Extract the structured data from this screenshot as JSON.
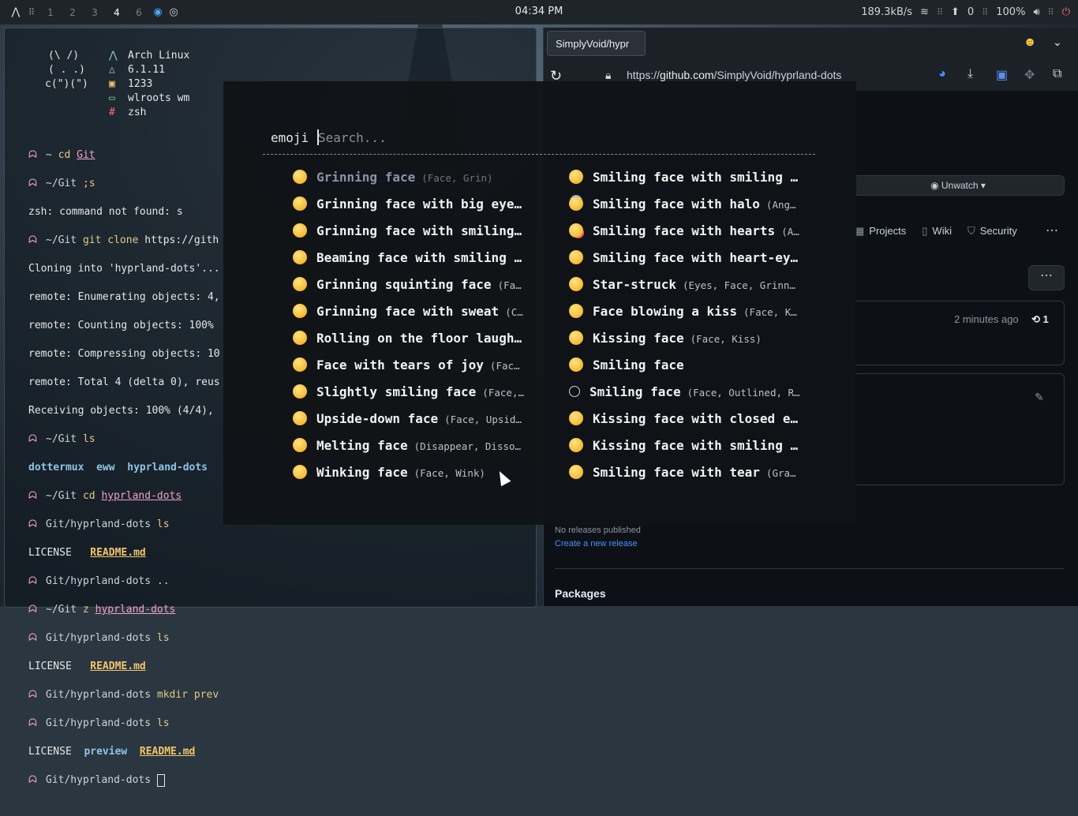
{
  "topbar": {
    "workspaces": [
      "1",
      "2",
      "3",
      "4",
      "6"
    ],
    "active_workspace": "4",
    "clock": "04:34 PM",
    "net_speed": "189.3kB/s",
    "updates": "0",
    "battery": "100%"
  },
  "terminal": {
    "art": [
      "(\\ /)",
      "( . .)",
      "c(\")(\")"
    ],
    "info": {
      "os": "Arch Linux",
      "kernel": "6.1.11",
      "packages": "1233",
      "wm": "wlroots wm",
      "shell": "zsh"
    },
    "lines": {
      "l1_path": "~",
      "l1_cmd": "cd",
      "l1_arg": "Git",
      "l2_path": "~/Git",
      "l2_cmd": ";s",
      "l3": "zsh: command not found: s",
      "l4_path": "~/Git",
      "l4_cmd": "git clone",
      "l4_arg": "https://gith",
      "l5": "Cloning into 'hyprland-dots'...",
      "l6": "remote: Enumerating objects: 4,",
      "l7": "remote: Counting objects: 100%",
      "l8": "remote: Compressing objects: 10",
      "l9": "remote: Total 4 (delta 0), reus",
      "l10": "Receiving objects: 100% (4/4),",
      "l11_path": "~/Git",
      "l11_cmd": "ls",
      "l12_a": "dottermux",
      "l12_b": "eww",
      "l12_c": "hyprland-dots",
      "l13_path": "~/Git",
      "l13_cmd": "cd",
      "l13_arg": "hyprland-dots",
      "l14_path": "Git/hyprland-dots",
      "l14_cmd": "ls",
      "l15_a": "LICENSE",
      "l15_b": "README.md",
      "l16_path": "Git/hyprland-dots",
      "l16_cmd": "..",
      "l17_path": "~/Git",
      "l17_cmd": "z",
      "l17_arg": "hyprland-dots",
      "l18_path": "Git/hyprland-dots",
      "l18_cmd": "ls",
      "l19_a": "LICENSE",
      "l19_b": "README.md",
      "l20_path": "Git/hyprland-dots",
      "l20_cmd": "mkdir prev",
      "l21_path": "Git/hyprland-dots",
      "l21_cmd": "ls",
      "l22_a": "LICENSE",
      "l22_b": "preview",
      "l22_c": "README.md",
      "l23_path": "Git/hyprland-dots"
    }
  },
  "browser": {
    "tab_title": "SimplyVoid/hypr",
    "url_scheme": "https://",
    "url_host": "github.com",
    "url_path": "/SimplyVoid/hyprland-dots",
    "unwatch_label": "Unwatch",
    "nav": [
      "Projects",
      "Wiki",
      "Security"
    ],
    "commit_time": "2 minutes ago",
    "commit_count": "1",
    "releases_none": "No releases published",
    "create_release": "Create a new release",
    "packages": "Packages"
  },
  "rofi": {
    "prompt": "emoji",
    "placeholder": "Search...",
    "left": [
      {
        "name": "Grinning face",
        "kw": "(Face, Grin)"
      },
      {
        "name": "Grinning face with big eye…",
        "kw": ""
      },
      {
        "name": "Grinning face with smiling…",
        "kw": ""
      },
      {
        "name": "Beaming face with smiling …",
        "kw": ""
      },
      {
        "name": "Grinning squinting face",
        "kw": "(Fa…"
      },
      {
        "name": "Grinning face with sweat",
        "kw": "(C…"
      },
      {
        "name": "Rolling on the floor laugh…",
        "kw": ""
      },
      {
        "name": "Face with tears of joy",
        "kw": "(Fac…"
      },
      {
        "name": "Slightly smiling face",
        "kw": "(Face,…"
      },
      {
        "name": "Upside-down face",
        "kw": "(Face, Upsid…"
      },
      {
        "name": "Melting face",
        "kw": "(Disappear, Disso…"
      },
      {
        "name": "Winking face",
        "kw": "(Face, Wink)"
      }
    ],
    "right": [
      {
        "name": "Smiling face with smiling …",
        "kw": ""
      },
      {
        "name": "Smiling face with halo",
        "kw": "(Ang…"
      },
      {
        "name": "Smiling face with hearts",
        "kw": "(A…"
      },
      {
        "name": "Smiling face with heart-ey…",
        "kw": ""
      },
      {
        "name": "Star-struck",
        "kw": "(Eyes, Face, Grinn…"
      },
      {
        "name": "Face blowing a kiss",
        "kw": "(Face, K…"
      },
      {
        "name": "Kissing face",
        "kw": "(Face, Kiss)"
      },
      {
        "name": "Smiling face",
        "kw": ""
      },
      {
        "name": "Smiling face",
        "kw": "(Face, Outlined, R…"
      },
      {
        "name": "Kissing face with closed e…",
        "kw": ""
      },
      {
        "name": "Kissing face with smiling …",
        "kw": ""
      },
      {
        "name": "Smiling face with tear",
        "kw": "(Gra…"
      }
    ]
  }
}
